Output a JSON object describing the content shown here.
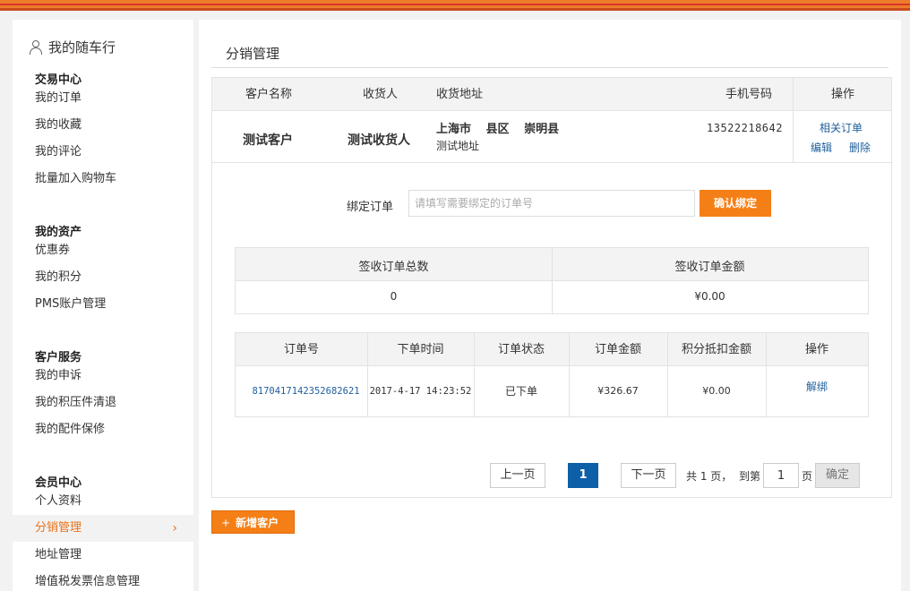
{
  "sidebar": {
    "title": "我的随车行",
    "groups": [
      {
        "title": "交易中心",
        "items": [
          "我的订单",
          "我的收藏",
          "我的评论",
          "批量加入购物车"
        ]
      },
      {
        "title": "我的资产",
        "items": [
          "优惠券",
          "我的积分",
          "PMS账户管理"
        ]
      },
      {
        "title": "客户服务",
        "items": [
          "我的申诉",
          "我的积压件清退",
          "我的配件保修"
        ]
      },
      {
        "title": "会员中心",
        "items": [
          "个人资料",
          "分销管理",
          "地址管理",
          "增值税发票信息管理"
        ]
      }
    ],
    "active_item": "分销管理",
    "chevron": "›"
  },
  "main": {
    "page_title": "分销管理",
    "customer_table": {
      "headers": [
        "客户名称",
        "收货人",
        "收货地址",
        "手机号码",
        "操作"
      ],
      "row": {
        "name": "测试客户",
        "receiver": "测试收货人",
        "address_region": [
          "上海市",
          "县区",
          "崇明县"
        ],
        "address_detail": "测试地址",
        "phone": "13522218642",
        "actions": {
          "related_orders": "相关订单",
          "edit": "编辑",
          "delete": "删除"
        }
      }
    },
    "bind": {
      "label": "绑定订单",
      "placeholder": "请填写需要绑定的订单号",
      "button": "确认绑定"
    },
    "summary_table": {
      "headers": [
        "签收订单总数",
        "签收订单金额"
      ],
      "values": [
        "0",
        "¥0.00"
      ]
    },
    "order_table": {
      "headers": [
        "订单号",
        "下单时间",
        "订单状态",
        "订单金额",
        "积分抵扣金额",
        "操作"
      ],
      "rows": [
        {
          "order_no": "8170417142352682621",
          "time": "2017-4-17 14:23:52",
          "status": "已下单",
          "amount": "¥326.67",
          "points": "¥0.00",
          "action": "解绑"
        }
      ]
    },
    "pager": {
      "prev": "上一页",
      "current": "1",
      "next": "下一页",
      "total_text": "共 1 页，",
      "goto_text": "到第",
      "goto_value": "1",
      "page_unit": "页",
      "confirm": "确定"
    },
    "add_customer": {
      "icon": "+",
      "label": "新增客户"
    }
  },
  "colors": {
    "accent": "#f57f17",
    "link": "#1f5f9c",
    "pager_current": "#0d5fa8"
  }
}
